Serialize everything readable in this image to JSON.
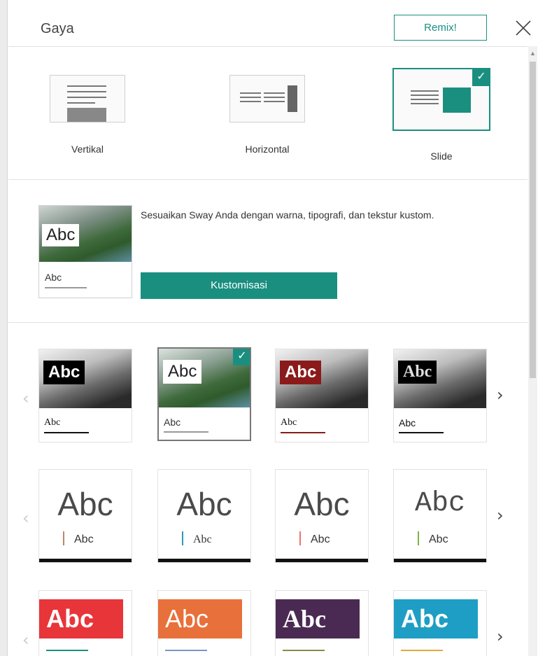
{
  "header": {
    "title": "Gaya",
    "remix_label": "Remix!"
  },
  "layouts": [
    {
      "label": "Vertikal",
      "selected": false
    },
    {
      "label": "Horizontal",
      "selected": false
    },
    {
      "label": "Slide",
      "selected": true
    }
  ],
  "customize": {
    "thumb_big": "Abc",
    "thumb_small": "Abc",
    "description": "Sesuaikan Sway Anda dengan warna, tipografi, dan tekstur kustom.",
    "button_label": "Kustomisasi"
  },
  "themes_row1": [
    {
      "abc": "Abc",
      "small": "Abc",
      "box_color": "#000000",
      "text_color": "#ffffff",
      "line_color": "#111111",
      "selected": false
    },
    {
      "abc": "Abc",
      "small": "Abc",
      "box_color": "#ffffff",
      "text_color": "#222222",
      "line_color": "#999999",
      "selected": true
    },
    {
      "abc": "Abc",
      "small": "Abc",
      "box_color": "#8b1a1a",
      "text_color": "#ffffff",
      "line_color": "#8b1a1a",
      "selected": false
    },
    {
      "abc": "Abc",
      "small": "Abc",
      "box_color": "#000000",
      "text_color": "#dddddd",
      "line_color": "#111111",
      "selected": false
    }
  ],
  "themes_row2": [
    {
      "abc": "Abc",
      "small": "Abc",
      "accent": "#c0866a"
    },
    {
      "abc": "Abc",
      "small": "Abc",
      "accent": "#2a9bb5"
    },
    {
      "abc": "Abc",
      "small": "Abc",
      "accent": "#f07070"
    },
    {
      "abc": "Abc",
      "small": "Abc",
      "accent": "#7cb342"
    }
  ],
  "themes_row3": [
    {
      "abc": "Abc",
      "color": "#e8353a"
    },
    {
      "abc": "Abc",
      "color": "#e8703a"
    },
    {
      "abc": "Abc",
      "color": "#4a2a52"
    },
    {
      "abc": "Abc",
      "color": "#1e9ec4"
    }
  ],
  "icons": {
    "close": "close-icon",
    "check": "check-icon",
    "prev": "chevron-left-icon",
    "next": "chevron-right-icon"
  }
}
